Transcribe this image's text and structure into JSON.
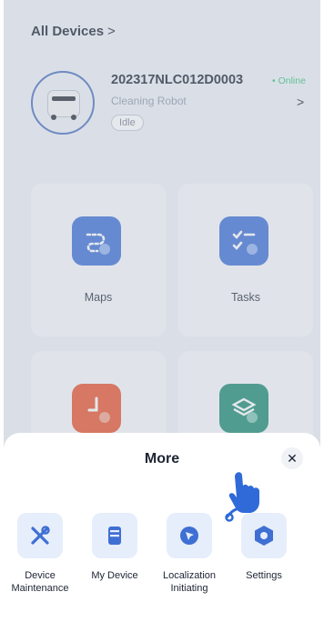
{
  "header": {
    "title": "All Devices",
    "chevron": ">"
  },
  "device": {
    "id": "202317NLC012D0003",
    "status": "• Online",
    "type": "Cleaning Robot",
    "state": "Idle",
    "chevron": ">"
  },
  "tiles": [
    {
      "label": "Maps",
      "color": "#3d6fd6"
    },
    {
      "label": "Tasks",
      "color": "#3d6fd6"
    },
    {
      "label": "",
      "color": "#e8532d"
    },
    {
      "label": "",
      "color": "#1d8a74"
    }
  ],
  "sheet": {
    "title": "More",
    "close": "✕",
    "options": [
      {
        "label": "Device Maintenance",
        "icon": "wrench-icon"
      },
      {
        "label": "My Device",
        "icon": "robot-icon"
      },
      {
        "label": "Localization Initiating",
        "icon": "location-icon"
      },
      {
        "label": "Settings",
        "icon": "settings-hexagon-icon"
      }
    ]
  },
  "colors": {
    "accent": "#4a7bdc",
    "online": "#39c07a",
    "hand": "#2f6ad8"
  }
}
